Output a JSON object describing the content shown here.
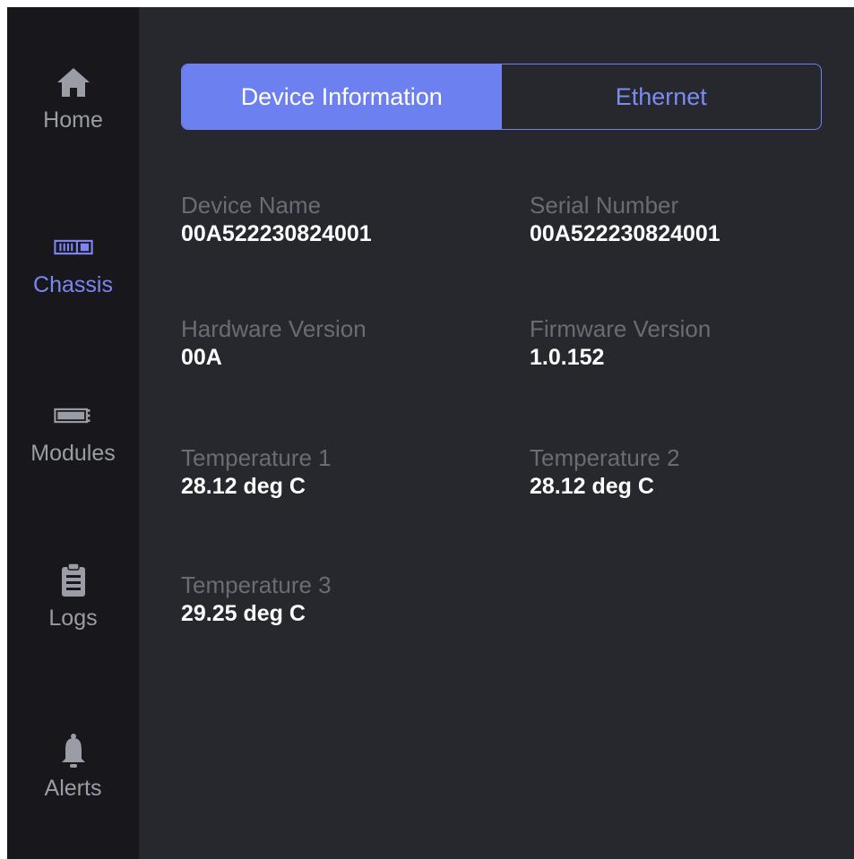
{
  "sidebar": {
    "items": [
      {
        "label": "Home",
        "icon": "home-icon",
        "active": false
      },
      {
        "label": "Chassis",
        "icon": "chassis-icon",
        "active": true
      },
      {
        "label": "Modules",
        "icon": "module-icon",
        "active": false
      },
      {
        "label": "Logs",
        "icon": "clipboard-icon",
        "active": false
      },
      {
        "label": "Alerts",
        "icon": "bell-icon",
        "active": false
      }
    ]
  },
  "tabs": [
    {
      "label": "Device Information",
      "active": true
    },
    {
      "label": "Ethernet",
      "active": false
    }
  ],
  "device_info": {
    "device_name": {
      "label": "Device Name",
      "value": "00A522230824001"
    },
    "serial_number": {
      "label": "Serial Number",
      "value": "00A522230824001"
    },
    "hardware_version": {
      "label": "Hardware Version",
      "value": "00A"
    },
    "firmware_version": {
      "label": "Firmware Version",
      "value": "1.0.152"
    },
    "temperature_1": {
      "label": "Temperature 1",
      "value": "28.12 deg C"
    },
    "temperature_2": {
      "label": "Temperature 2",
      "value": "28.12 deg C"
    },
    "temperature_3": {
      "label": "Temperature 3",
      "value": "29.25 deg C"
    }
  },
  "colors": {
    "sidebar_bg": "#18181c",
    "main_bg": "#27282e",
    "accent": "#6d80f0",
    "label_gray": "#6a6c75",
    "nav_gray": "#9a9ca6"
  }
}
